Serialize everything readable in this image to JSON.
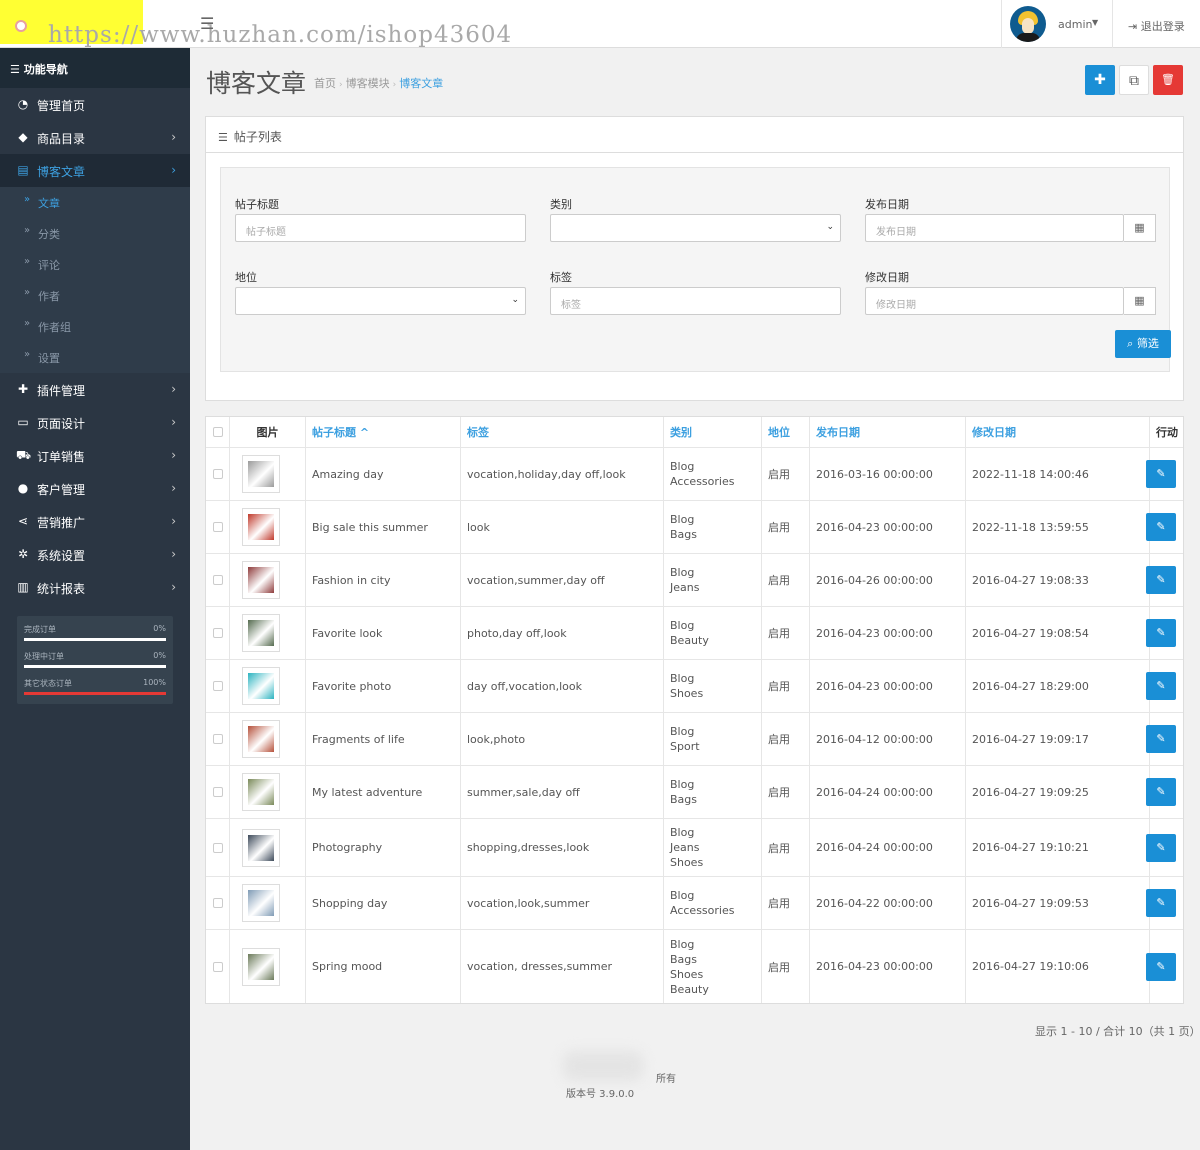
{
  "header": {
    "watermark": "https://www.huzhan.com/ishop43604",
    "menu_icon": "☰",
    "admin_name": "admin",
    "logout": "⇥ 退出登录"
  },
  "sidebar": {
    "title": "☰ 功能导航",
    "items": [
      {
        "icon": "dashboard-icon",
        "glyph": "◔",
        "label": "管理首页",
        "chevron": ""
      },
      {
        "icon": "tags-icon",
        "glyph": "◆",
        "label": "商品目录",
        "chevron": "›"
      },
      {
        "icon": "newspaper-icon",
        "glyph": "▤",
        "label": "博客文章",
        "chevron": "›"
      },
      {
        "icon": "puzzle-icon",
        "glyph": "✚",
        "label": "插件管理",
        "chevron": "›"
      },
      {
        "icon": "desktop-icon",
        "glyph": "▭",
        "label": "页面设计",
        "chevron": "›"
      },
      {
        "icon": "cart-icon",
        "glyph": "⛟",
        "label": "订单销售",
        "chevron": "›"
      },
      {
        "icon": "user-icon",
        "glyph": "●",
        "label": "客户管理",
        "chevron": "›"
      },
      {
        "icon": "share-icon",
        "glyph": "⋖",
        "label": "营销推广",
        "chevron": "›"
      },
      {
        "icon": "gear-icon",
        "glyph": "✲",
        "label": "系统设置",
        "chevron": "›"
      },
      {
        "icon": "bar-chart-icon",
        "glyph": "▥",
        "label": "统计报表",
        "chevron": "›"
      }
    ],
    "subitems": [
      "文章",
      "分类",
      "评论",
      "作者",
      "作者组",
      "设置"
    ],
    "stats": [
      {
        "label": "完成订单",
        "percent": "0%",
        "value": 0,
        "color": "#3da0e0"
      },
      {
        "label": "处理中订单",
        "percent": "0%",
        "value": 0,
        "color": "#3da0e0"
      },
      {
        "label": "其它状态订单",
        "percent": "100%",
        "value": 1,
        "color": "#e53935"
      }
    ]
  },
  "page": {
    "title": "博客文章",
    "breadcrumb": [
      "首页",
      "博客模块",
      "博客文章"
    ],
    "btn_add": "✚",
    "btn_copy": "⧉",
    "btn_delete": "🗑",
    "colors": {
      "primary": "#1a8fd6",
      "danger": "#e53935"
    }
  },
  "filter": {
    "panel_title": "帖子列表",
    "title_label": "帖子标题",
    "title_placeholder": "帖子标题",
    "category_label": "类别",
    "date_label": "发布日期",
    "date_placeholder": "发布日期",
    "status_label": "地位",
    "tag_label": "标签",
    "tag_placeholder": "标签",
    "modified_label": "修改日期",
    "modified_placeholder": "修改日期",
    "button": "筛选",
    "calendar": "▦",
    "caret": "⌄"
  },
  "table": {
    "headers": {
      "image": "图片",
      "title": "帖子标题 ^",
      "tags": "标签",
      "category": "类别",
      "status": "地位",
      "date": "发布日期",
      "modified": "修改日期",
      "action": "行动"
    },
    "rows": [
      {
        "title": "Amazing day",
        "tags": "vocation,holiday,day off,look",
        "category": "Blog\nAccessories",
        "status": "启用",
        "date": "2016-03-16 00:00:00",
        "modified": "2022-11-18 14:00:46",
        "thumb": "#9a9a9a"
      },
      {
        "title": "Big sale this summer",
        "tags": "look",
        "category": "Blog\nBags",
        "status": "启用",
        "date": "2016-04-23 00:00:00",
        "modified": "2022-11-18 13:59:55",
        "thumb": "#c0392b"
      },
      {
        "title": "Fashion in city",
        "tags": "vocation,summer,day off",
        "category": "Blog\nJeans",
        "status": "启用",
        "date": "2016-04-26 00:00:00",
        "modified": "2016-04-27 19:08:33",
        "thumb": "#8e3b3b"
      },
      {
        "title": "Favorite look",
        "tags": "photo,day off,look",
        "category": "Blog\nBeauty",
        "status": "启用",
        "date": "2016-04-23 00:00:00",
        "modified": "2016-04-27 19:08:54",
        "thumb": "#556b4f"
      },
      {
        "title": "Favorite photo",
        "tags": "day off,vocation,look",
        "category": "Blog\nShoes",
        "status": "启用",
        "date": "2016-04-23 00:00:00",
        "modified": "2016-04-27 18:29:00",
        "thumb": "#2bb3c0"
      },
      {
        "title": "Fragments of life",
        "tags": "look,photo",
        "category": "Blog\nSport",
        "status": "启用",
        "date": "2016-04-12 00:00:00",
        "modified": "2016-04-27 19:09:17",
        "thumb": "#b5503a"
      },
      {
        "title": "My latest adventure",
        "tags": "summer,sale,day off",
        "category": "Blog\nBags",
        "status": "启用",
        "date": "2016-04-24 00:00:00",
        "modified": "2016-04-27 19:09:25",
        "thumb": "#7a8a5a"
      },
      {
        "title": "Photography",
        "tags": "shopping,dresses,look",
        "category": "Blog\nJeans\nShoes",
        "status": "启用",
        "date": "2016-04-24 00:00:00",
        "modified": "2016-04-27 19:10:21",
        "thumb": "#3d4a5a"
      },
      {
        "title": "Shopping day",
        "tags": "vocation,look,summer",
        "category": "Blog\nAccessories",
        "status": "启用",
        "date": "2016-04-22 00:00:00",
        "modified": "2016-04-27 19:09:53",
        "thumb": "#7f9bb5"
      },
      {
        "title": "Spring mood",
        "tags": "vocation, dresses,summer",
        "category": "Blog\nBags\nShoes\nBeauty",
        "status": "启用",
        "date": "2016-04-23 00:00:00",
        "modified": "2016-04-27 19:10:06",
        "thumb": "#6b7a5a"
      }
    ],
    "edit_glyph": "✎"
  },
  "pager": "显示 1 - 10 / 合计 10（共 1 页）",
  "footer": {
    "line1": "所有",
    "line2": "版本号 3.9.0.0"
  }
}
